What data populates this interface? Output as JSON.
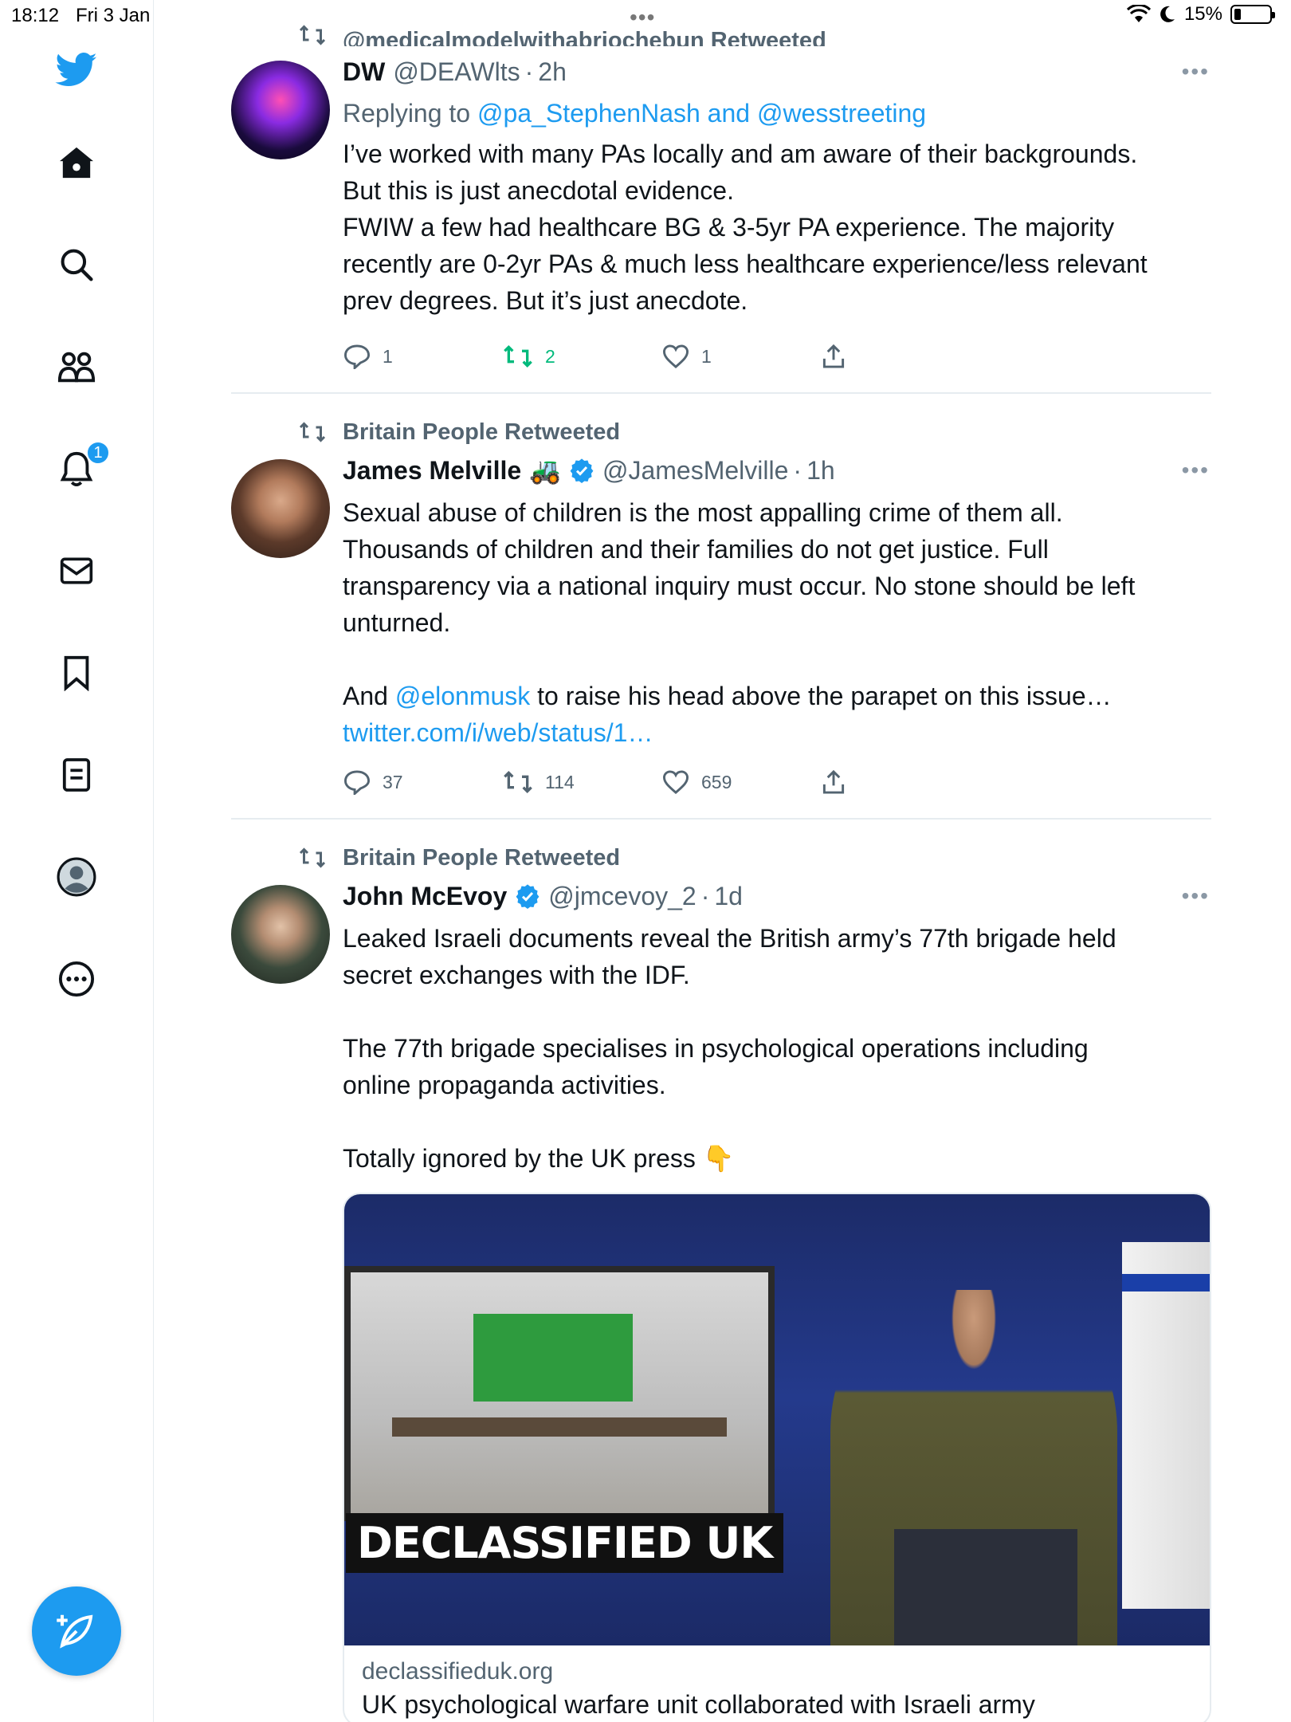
{
  "status_bar": {
    "time": "18:12",
    "date": "Fri 3 Jan",
    "battery": "15%"
  },
  "sidebar": {
    "notifications_badge": "1",
    "items": [
      "home-icon",
      "search-icon",
      "communities-icon",
      "notifications-icon",
      "messages-icon",
      "bookmarks-icon",
      "lists-icon",
      "profile-icon",
      "more-icon"
    ]
  },
  "tweets": [
    {
      "retweeted_by": "@medicalmodelwithabriochebun Retweeted",
      "name": "DW",
      "handle": "@DEAWlts",
      "time": "2h",
      "reply_prefix": "Replying to",
      "reply_mentions": "@pa_StephenNash and @wesstreeting",
      "lines": [
        "I’ve worked with many PAs locally and am aware of their backgrounds.",
        "But this is just anecdotal evidence.",
        "FWIW a few had healthcare BG & 3-5yr PA experience. The majority",
        "recently are 0-2yr PAs & much less healthcare experience/less relevant",
        "prev degrees. But it’s just anecdote."
      ],
      "replies": "1",
      "retweets": "2",
      "likes": "1"
    },
    {
      "retweeted_by": "Britain People Retweeted",
      "name": "James Melville",
      "name_emoji": "🚜",
      "handle": "@JamesMelville",
      "time": "1h",
      "lines": [
        "Sexual abuse of children is the most appalling crime of them all.",
        "Thousands of children and their families do not get justice. Full",
        "transparency via a national inquiry must occur. No stone should be left",
        "unturned."
      ],
      "line_and": "And",
      "mention": "@elonmusk",
      "line_after_mention": "to raise his head above the parapet on this issue…",
      "link": "twitter.com/i/web/status/1…",
      "replies": "37",
      "retweets": "114",
      "likes": "659"
    },
    {
      "retweeted_by": "Britain People Retweeted",
      "name": "John McEvoy",
      "handle": "@jmcevoy_2",
      "time": "1d",
      "lines": [
        "Leaked Israeli documents reveal the British army’s 77th brigade held",
        "secret exchanges with the IDF."
      ],
      "lines2": [
        "The 77th brigade specialises in psychological operations including",
        "online propaganda activities."
      ],
      "last_line": "Totally ignored by the UK press",
      "last_emoji": "👇",
      "card": {
        "image_caption": "DECLASSIFIED UK",
        "domain": "declassifieduk.org",
        "title": "UK psychological warfare unit collaborated with Israeli army"
      }
    }
  ],
  "colors": {
    "accent": "#1d9bf0",
    "retweet_green": "#00ba7c",
    "secondary_text": "#536471",
    "divider": "#e6ecf0"
  }
}
